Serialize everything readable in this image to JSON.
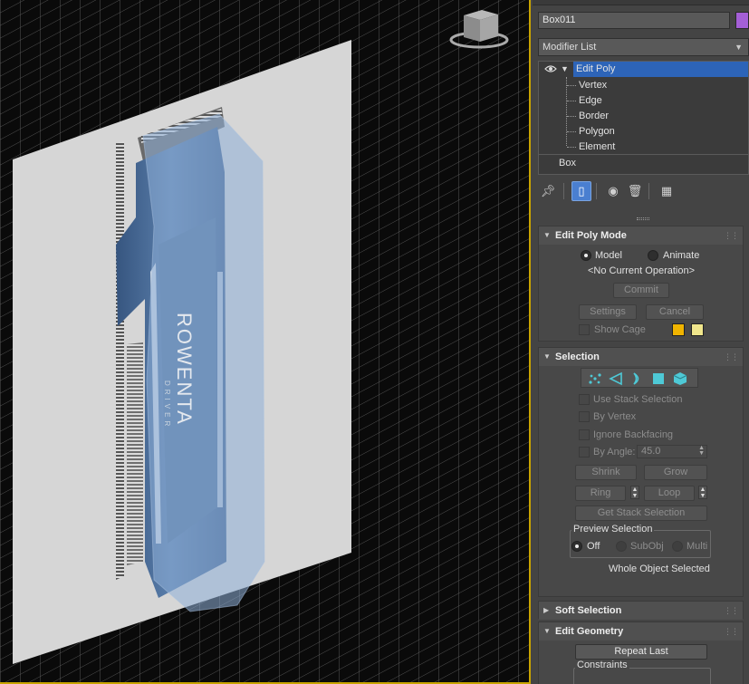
{
  "panel": {
    "object_name": "Box011",
    "object_color": "#a45fd6",
    "modifier_list_label": "Modifier List",
    "stack": {
      "top_modifier": "Edit Poly",
      "sub_objects": [
        "Vertex",
        "Edge",
        "Border",
        "Polygon",
        "Element"
      ],
      "base_object": "Box"
    },
    "toolbar_icons": [
      "pin-stack-icon",
      "show-end-result-icon",
      "make-unique-icon",
      "remove-modifier-icon",
      "configure-modifier-sets-icon"
    ]
  },
  "edit_poly_mode": {
    "title": "Edit Poly Mode",
    "model_label": "Model",
    "animate_label": "Animate",
    "status": "<No Current Operation>",
    "commit_label": "Commit",
    "settings_label": "Settings",
    "cancel_label": "Cancel",
    "show_cage_label": "Show Cage",
    "cage_colors": [
      "#f0b400",
      "#f0e68c"
    ]
  },
  "selection": {
    "title": "Selection",
    "modes": [
      "vertex-icon",
      "edge-icon",
      "border-icon",
      "polygon-icon",
      "element-icon"
    ],
    "use_stack_selection": "Use Stack Selection",
    "by_vertex": "By Vertex",
    "ignore_backfacing": "Ignore Backfacing",
    "by_angle": "By Angle:",
    "angle_value": "45.0",
    "shrink": "Shrink",
    "grow": "Grow",
    "ring": "Ring",
    "loop": "Loop",
    "get_stack_selection": "Get Stack Selection",
    "preview_title": "Preview Selection",
    "preview_off": "Off",
    "preview_subobj": "SubObj",
    "preview_multi": "Multi",
    "status": "Whole Object Selected"
  },
  "soft_selection": {
    "title": "Soft Selection"
  },
  "edit_geometry": {
    "title": "Edit Geometry",
    "repeat_last": "Repeat Last",
    "constraints": "Constraints"
  },
  "viewport": {
    "image_text": "ROWENTA",
    "image_subtext": "DRIVER",
    "accent_color": "#c8a400"
  }
}
